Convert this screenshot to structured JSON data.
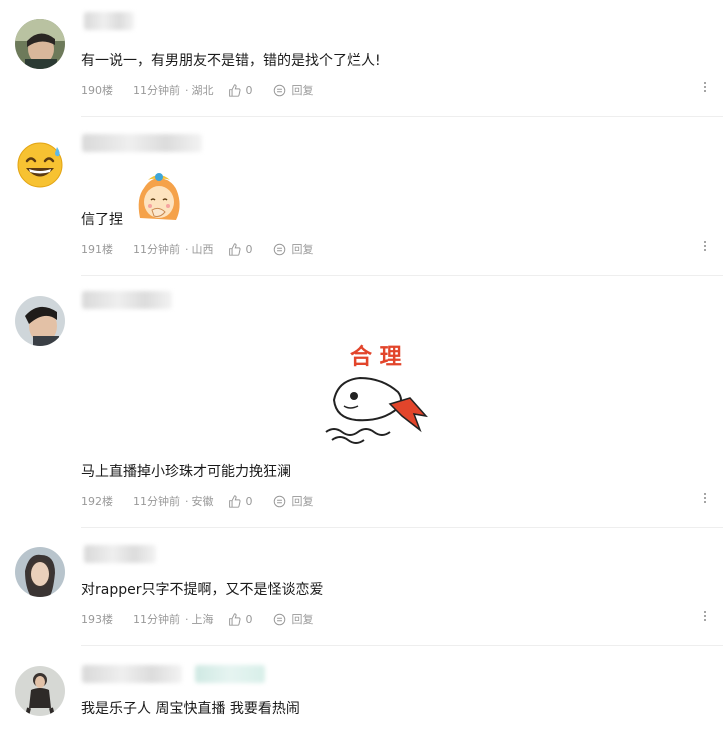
{
  "comments": [
    {
      "text": "有一说一，有男朋友不是错，错的是找个了烂人!",
      "floor": "190楼",
      "time": "11分钟前",
      "location": "湖北",
      "likes": "0",
      "reply": "回复"
    },
    {
      "text": "信了捏",
      "floor": "191楼",
      "time": "11分钟前",
      "location": "山西",
      "likes": "0",
      "reply": "回复"
    },
    {
      "text": "马上直播掉小珍珠才可能力挽狂澜",
      "sticker_text": "合 理",
      "floor": "192楼",
      "time": "11分钟前",
      "location": "安徽",
      "likes": "0",
      "reply": "回复"
    },
    {
      "text": "对rapper只字不提啊，又不是怪谈恋爱",
      "floor": "193楼",
      "time": "11分钟前",
      "location": "上海",
      "likes": "0",
      "reply": "回复"
    },
    {
      "text": "我是乐子人 周宝快直播 我要看热闹"
    }
  ],
  "icons": {
    "like": "thumbs-up-icon",
    "reply": "reply-icon",
    "more": "more-vertical-icon"
  },
  "colors": {
    "meta_text": "#999999",
    "body_text": "#1a1a1a",
    "divider": "#eeeeee",
    "sticker_red": "#e2452b"
  }
}
